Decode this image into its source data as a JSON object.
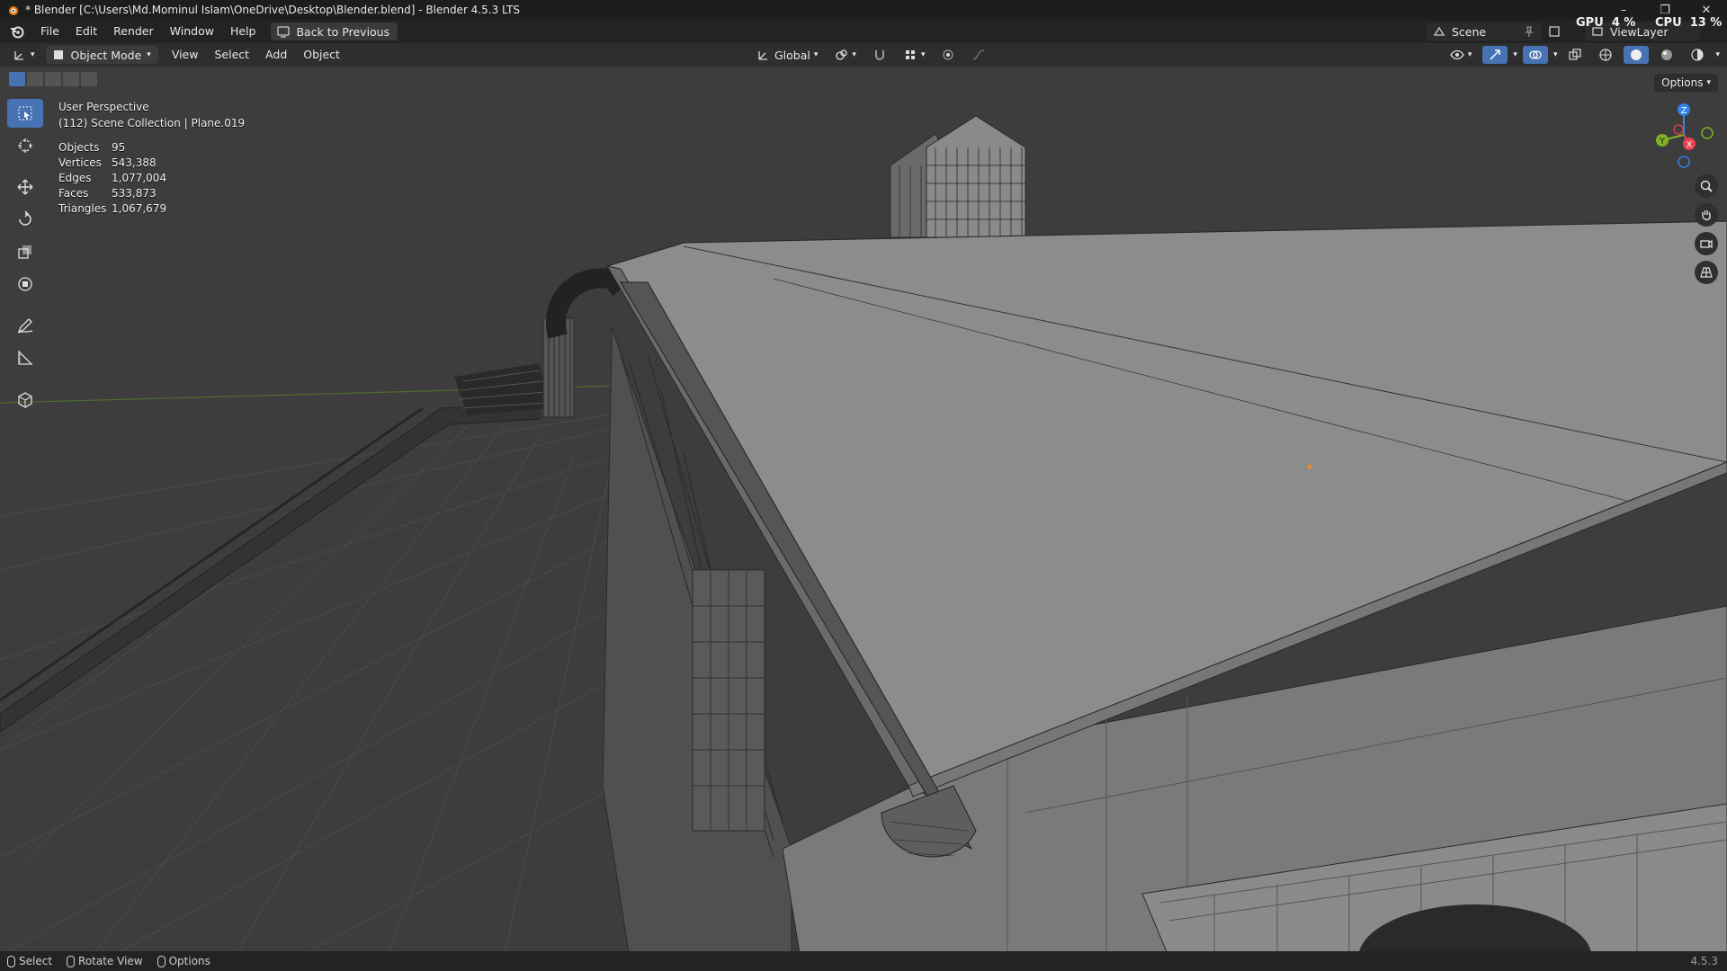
{
  "window": {
    "title": "* Blender [C:\\Users\\Md.Mominul Islam\\OneDrive\\Desktop\\Blender.blend] - Blender 4.5.3 LTS",
    "minimize": "–",
    "maximize": "❐",
    "close": "✕"
  },
  "menu": {
    "file": "File",
    "edit": "Edit",
    "render": "Render",
    "window": "Window",
    "help": "Help",
    "back_to_previous": "Back to Previous"
  },
  "topbar_right": {
    "scene": "Scene",
    "view_layer": "ViewLayer",
    "gpu_label": "GPU",
    "gpu_value": "4 %",
    "cpu_label": "CPU",
    "cpu_value": "13 %"
  },
  "viewport_header": {
    "mode": "Object Mode",
    "view": "View",
    "select": "Select",
    "add": "Add",
    "object": "Object",
    "transform_orientation": "Global"
  },
  "overlay": {
    "perspective": "User Perspective",
    "collection": "(112) Scene Collection | Plane.019",
    "stats": [
      {
        "label": "Objects",
        "value": "95"
      },
      {
        "label": "Vertices",
        "value": "543,388"
      },
      {
        "label": "Edges",
        "value": "1,077,004"
      },
      {
        "label": "Faces",
        "value": "533,873"
      },
      {
        "label": "Triangles",
        "value": "1,067,679"
      }
    ],
    "options": "Options"
  },
  "gizmo": {
    "z": "Z",
    "y": "Y",
    "x": "X"
  },
  "statusbar": {
    "select": "Select",
    "rotate_view": "Rotate View",
    "options": "Options",
    "version": "4.5.3"
  },
  "colors": {
    "accent": "#4772b3",
    "axis_x": "#e8414f",
    "axis_y": "#7fb324",
    "axis_z": "#2f83e3"
  }
}
